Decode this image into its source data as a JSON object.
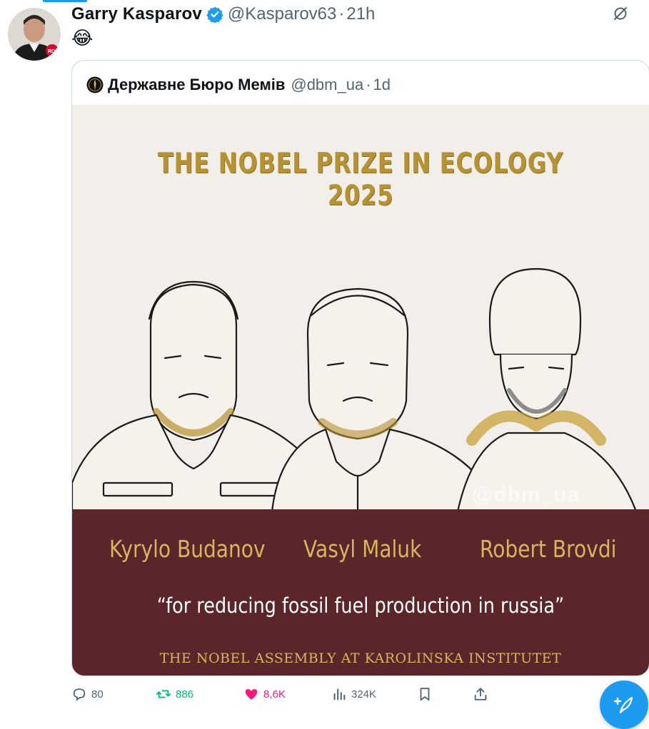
{
  "tweet": {
    "author_name": "Garry Kasparov",
    "author_handle": "@Kasparov63",
    "separator": "·",
    "time": "21h",
    "text": "😂",
    "avatar_badge": "RDI"
  },
  "quote": {
    "author_name": "Державне Бюро Мемів",
    "author_handle": "@dbm_ua",
    "separator": "·",
    "time": "1d",
    "image": {
      "title": "THE NOBEL PRIZE IN ECOLOGY 2025",
      "laureates": [
        "Kyrylo Budanov",
        "Vasyl Maluk",
        "Robert Brovdi"
      ],
      "citation": "“for reducing fossil fuel production in russia”",
      "assembly": "THE NOBEL ASSEMBLY AT KAROLINSKA INSTITUTET",
      "watermark": "@dbm_ua"
    }
  },
  "actions": {
    "replies": "80",
    "retweets": "886",
    "likes": "8,6K",
    "views": "324K"
  },
  "colors": {
    "accent": "#1d9bf0",
    "retweet": "#00ba7c",
    "like": "#f91880",
    "maroon": "#5a262a",
    "gold": "#d6b563"
  },
  "icons": [
    "verified-badge-icon",
    "grok-icon",
    "reply-icon",
    "retweet-icon",
    "like-icon",
    "views-icon",
    "bookmark-icon",
    "share-icon",
    "compose-icon"
  ]
}
